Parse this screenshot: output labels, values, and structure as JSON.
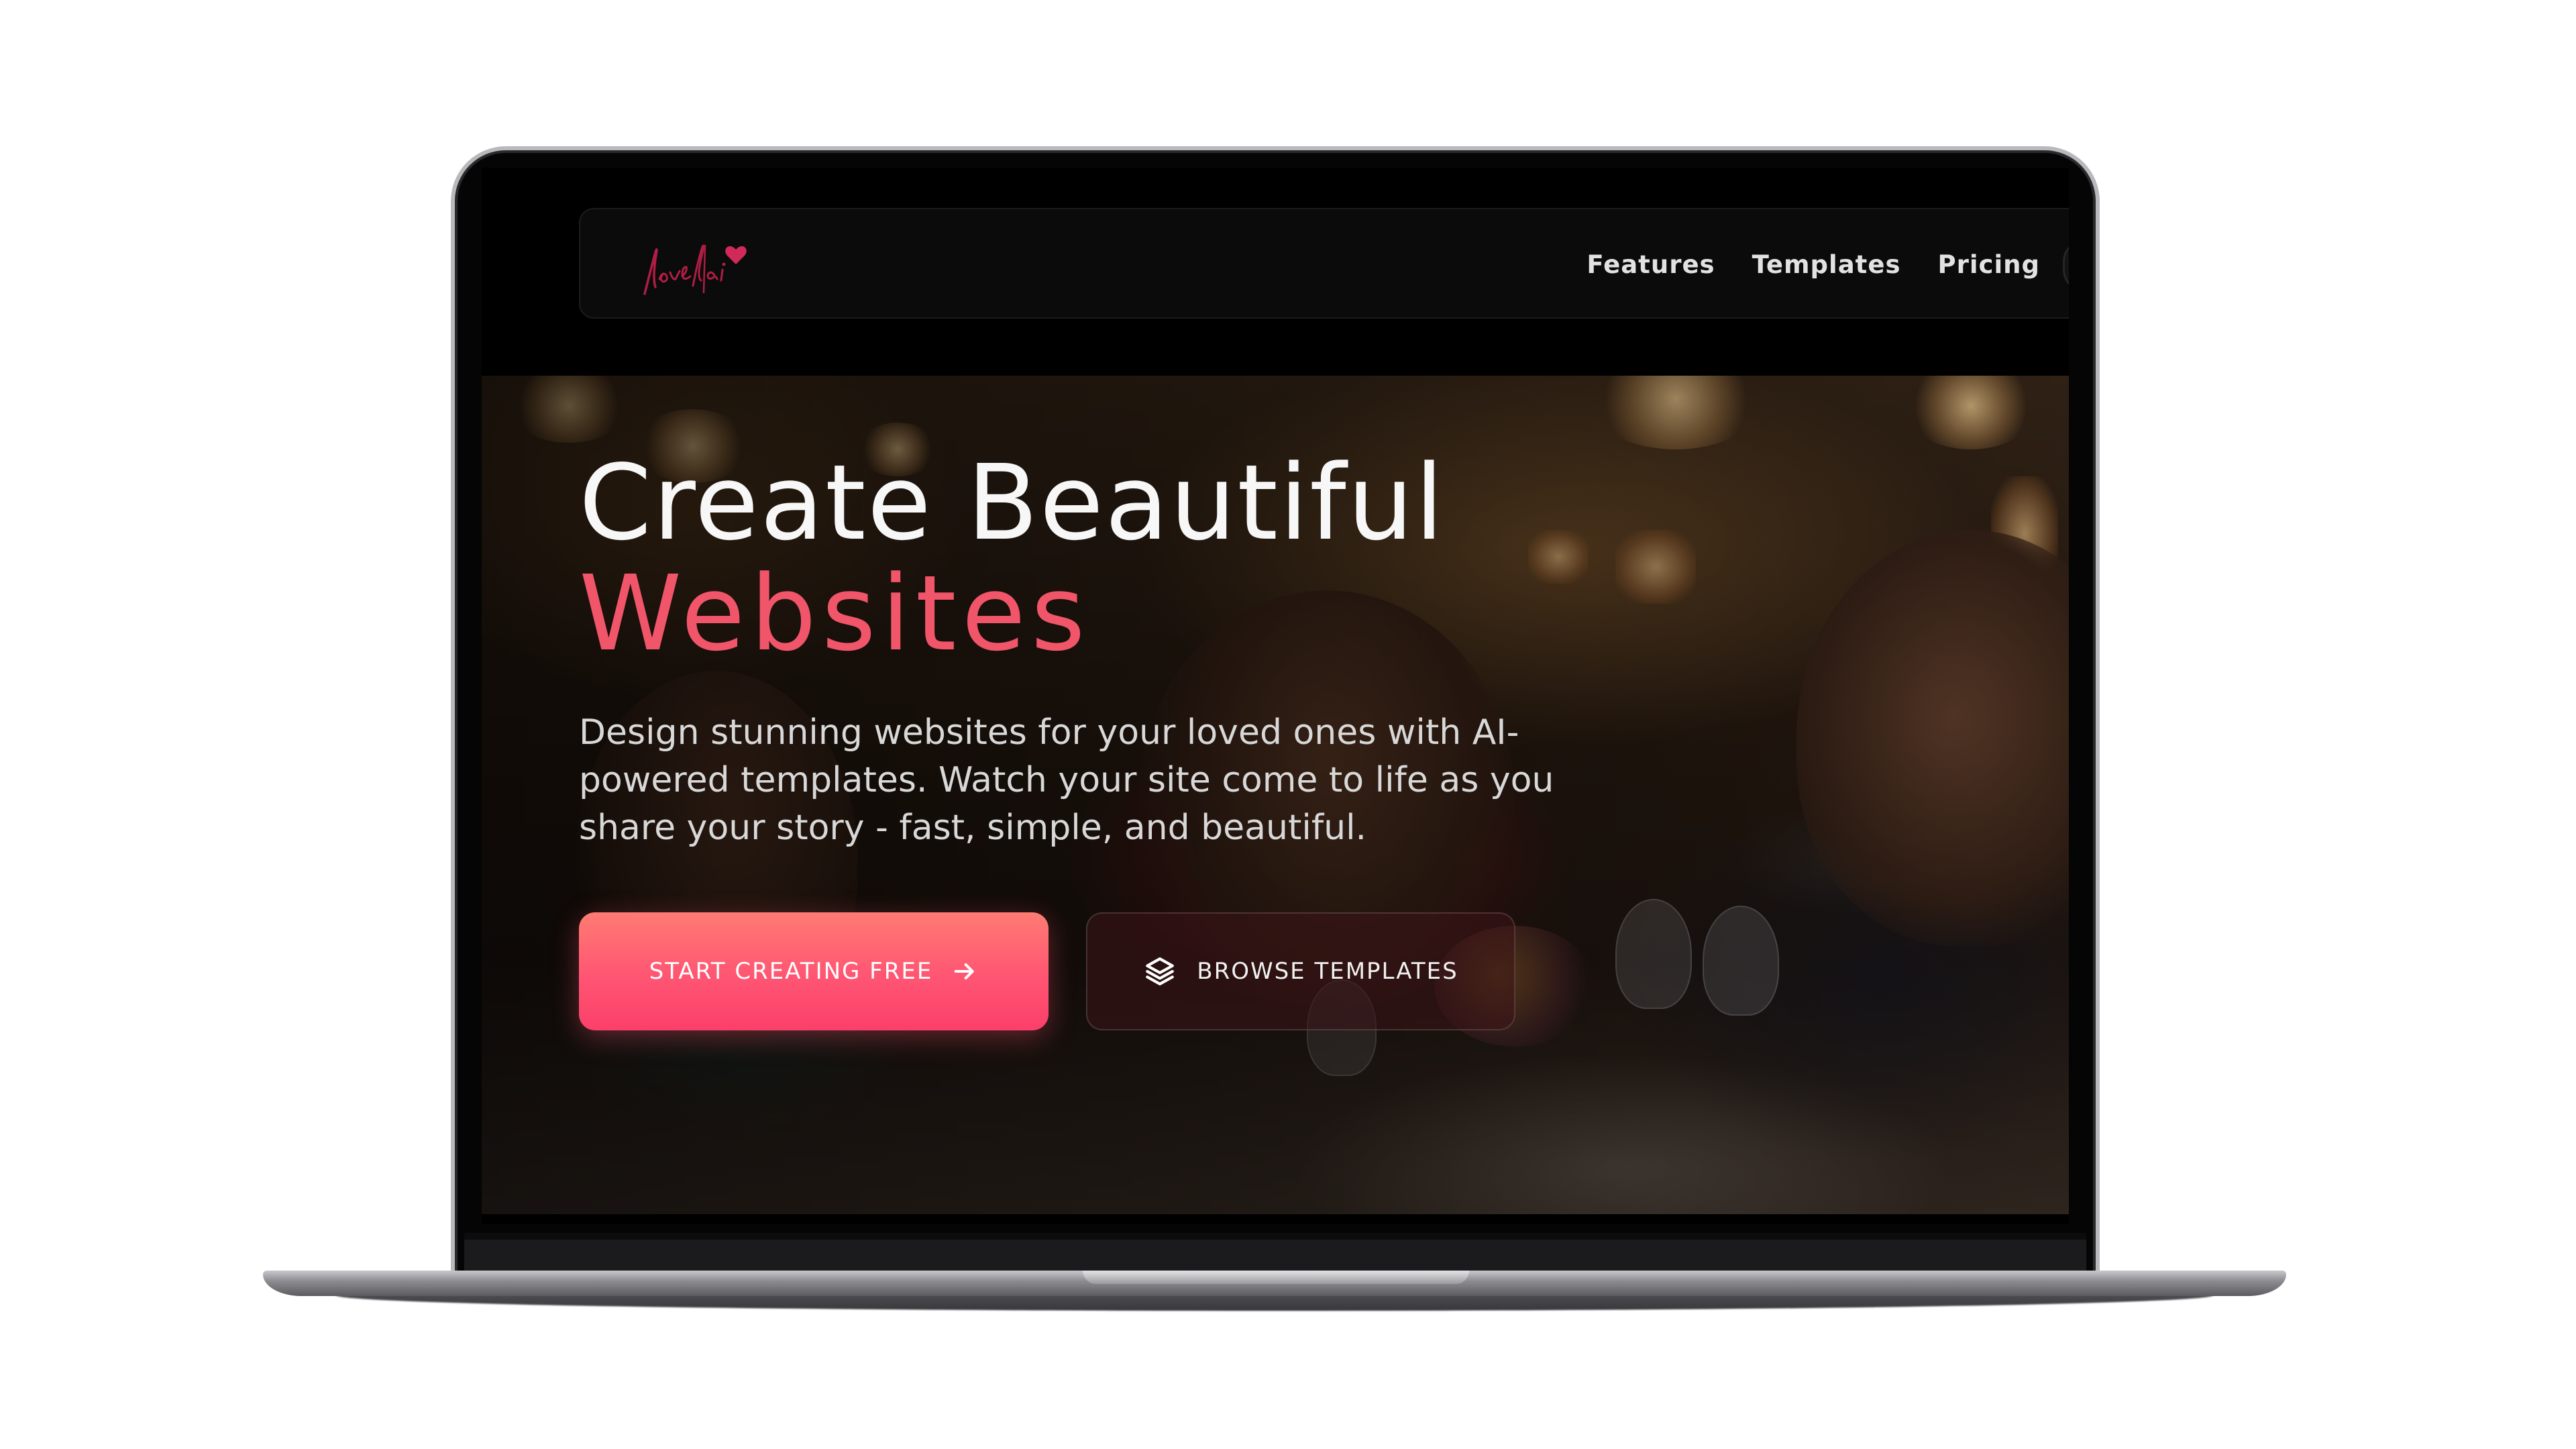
{
  "brand": {
    "logo_text": "love|ai",
    "accent_color": "#f0556a",
    "heart_color": "#c2204a"
  },
  "nav": {
    "items": [
      {
        "label": "Features"
      },
      {
        "label": "Templates"
      },
      {
        "label": "Pricing"
      }
    ]
  },
  "hero": {
    "title_line1": "Create Beautiful",
    "title_line2": "Websites",
    "subtitle": "Design stunning websites for your loved ones with AI-powered templates. Watch your site come to life as you share your story - fast, simple, and beautiful.",
    "primary_button": {
      "label": "START CREATING FREE",
      "icon": "arrow-right-icon"
    },
    "secondary_button": {
      "label": "BROWSE TEMPLATES",
      "icon": "layers-icon"
    },
    "background_image": "restaurant-dinner-photo"
  }
}
